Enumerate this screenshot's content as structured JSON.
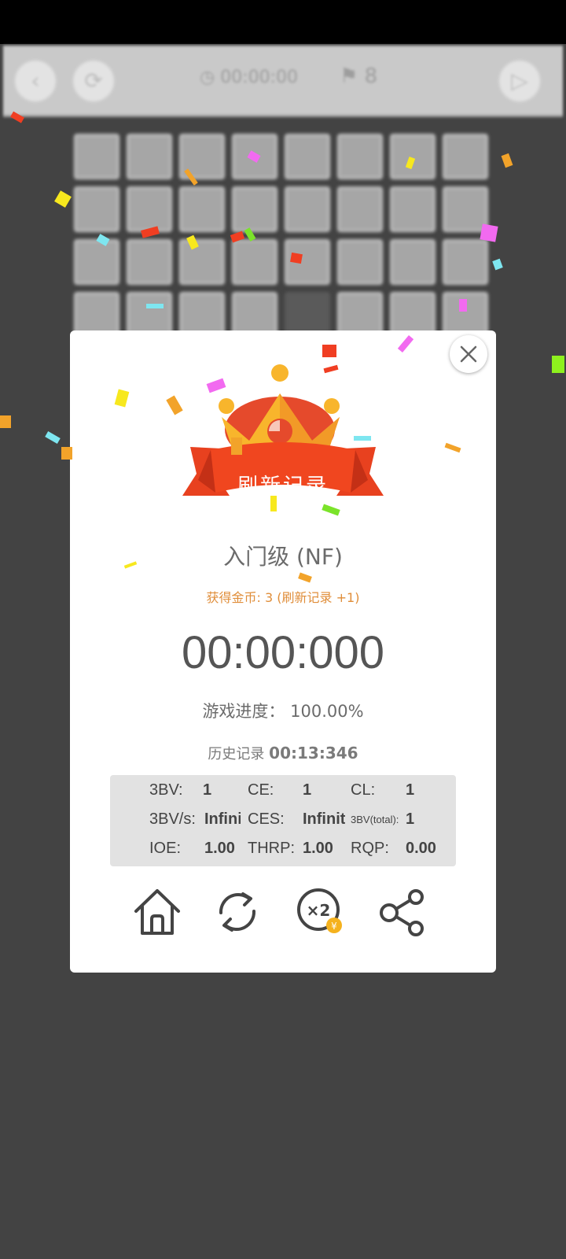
{
  "game": {
    "timer_display": "00:00:00",
    "flag_count": "8"
  },
  "dialog": {
    "banner": "刷新记录",
    "level": "入门级 (NF)",
    "coins": "获得金币: 3 (刷新记录 +1)",
    "time": "00:00:000",
    "progress": "游戏进度：  100.00%",
    "history_label": "历史记录",
    "history_value": "00:13:346",
    "stats": [
      {
        "label": "3BV:",
        "value": "1"
      },
      {
        "label": "CE:",
        "value": "1"
      },
      {
        "label": "CL:",
        "value": "1"
      },
      {
        "label": "3BV/s:",
        "value": "Infini"
      },
      {
        "label": "CES:",
        "value": "Infinit"
      },
      {
        "label": "3BV(total):",
        "value": "1"
      },
      {
        "label": "IOE:",
        "value": "1.00"
      },
      {
        "label": "THRP:",
        "value": "1.00"
      },
      {
        "label": "RQP:",
        "value": "0.00"
      }
    ]
  },
  "icons": {
    "back": "chevron-left-icon",
    "restart": "refresh-icon",
    "timer": "clock-icon",
    "flag": "flag-icon",
    "play": "play-icon",
    "close": "close-icon",
    "home": "home-icon",
    "replay": "replay-icon",
    "double": "double-coins-icon",
    "share": "share-icon"
  },
  "colors": {
    "background": "#434343",
    "dialog": "#ffffff",
    "ribbon": "#e8411f",
    "crown": "#f7b52a",
    "coin_text": "#e08e3a",
    "time_text": "#555555"
  }
}
